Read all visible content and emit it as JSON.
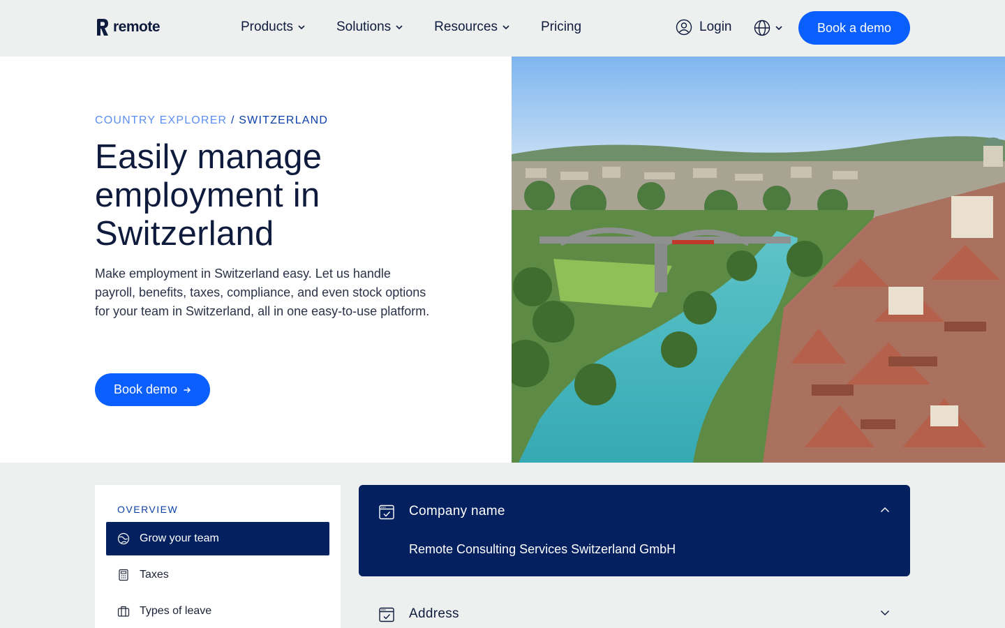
{
  "brand": {
    "name": "remote"
  },
  "nav": {
    "items": [
      {
        "label": "Products",
        "has_dropdown": true
      },
      {
        "label": "Solutions",
        "has_dropdown": true
      },
      {
        "label": "Resources",
        "has_dropdown": true
      },
      {
        "label": "Pricing",
        "has_dropdown": false
      }
    ],
    "login_label": "Login",
    "language_icon": "globe-icon",
    "cta_label": "Book a demo"
  },
  "hero": {
    "breadcrumb": {
      "parent": "COUNTRY EXPLORER",
      "separator": "/",
      "current": "SWITZERLAND"
    },
    "title": "Easily manage employment in Switzerland",
    "description": "Make employment in Switzerland easy. Let us handle payroll, benefits, taxes, compliance, and even stock options for your team in Switzerland, all in one easy-to-use platform.",
    "cta_label": "Book demo",
    "image_alt": "Aerial view of Bern old town with bridge over the Aare river"
  },
  "sidebar": {
    "heading": "OVERVIEW",
    "items": [
      {
        "label": "Grow your team",
        "icon": "globe-hand-icon",
        "active": true
      },
      {
        "label": "Taxes",
        "icon": "calculator-icon",
        "active": false
      },
      {
        "label": "Types of leave",
        "icon": "suitcase-icon",
        "active": false
      }
    ]
  },
  "accordion": [
    {
      "title": "Company name",
      "value": "Remote Consulting Services Switzerland GmbH",
      "expanded": true,
      "icon": "calendar-check-icon"
    },
    {
      "title": "Address",
      "expanded": false,
      "icon": "calendar-check-icon"
    }
  ],
  "colors": {
    "primary": "#0b5fff",
    "navy": "#04205e",
    "text": "#0f1b3d",
    "background": "#eef0f0",
    "breadcrumb_light": "#5b8ef0"
  }
}
